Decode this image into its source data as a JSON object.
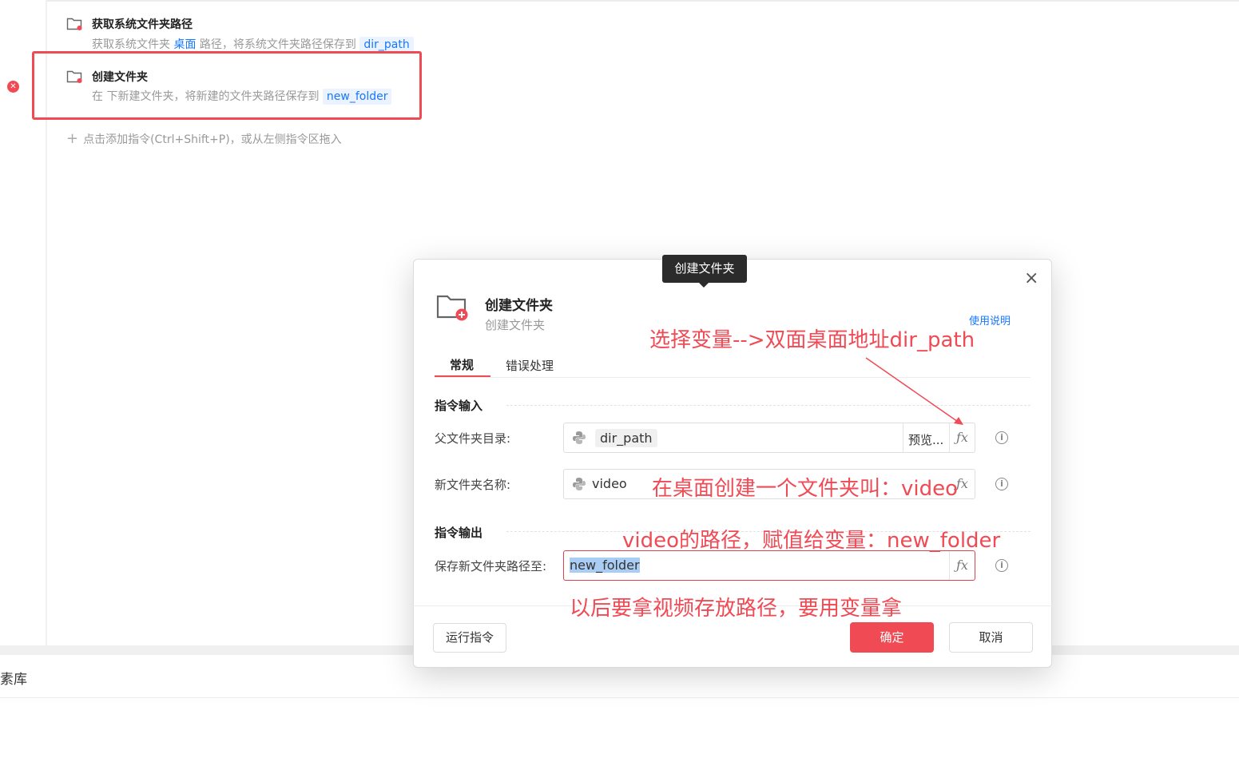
{
  "steps": [
    {
      "title": "获取系统文件夹路径",
      "desc_prefix": "获取系统文件夹",
      "desc_link": "桌面",
      "desc_middle": "路径，将系统文件夹路径保存到",
      "desc_var": "dir_path"
    },
    {
      "title": "创建文件夹",
      "desc_prefix": "在 下新建文件夹，将新建的文件夹路径保存到",
      "desc_var": "new_folder"
    }
  ],
  "add_hint": "点击添加指令(Ctrl+Shift+P)，或从左侧指令区拖入",
  "bottom_tab": "素库",
  "tooltip": "创建文件夹",
  "dialog": {
    "title": "创建文件夹",
    "subtitle": "创建文件夹",
    "help": "使用说明",
    "tabs": [
      "常规",
      "错误处理"
    ],
    "input_section": "指令输入",
    "output_section": "指令输出",
    "fields": [
      {
        "label": "父文件夹目录:",
        "value": "dir_path",
        "preview": "预览..."
      },
      {
        "label": "新文件夹名称:",
        "value": "video"
      },
      {
        "label": "保存新文件夹路径至:",
        "value": "new_folder"
      }
    ],
    "buttons": {
      "run": "运行指令",
      "ok": "确定",
      "cancel": "取消"
    }
  },
  "annotations": [
    "选择变量-->双面桌面地址dir_path",
    "在桌面创建一个文件夹叫：video",
    "video的路径，赋值给变量：new_folder",
    "以后要拿视频存放路径，要用变量拿"
  ],
  "colors": {
    "accent": "#f04a55",
    "link": "#1677ff"
  }
}
